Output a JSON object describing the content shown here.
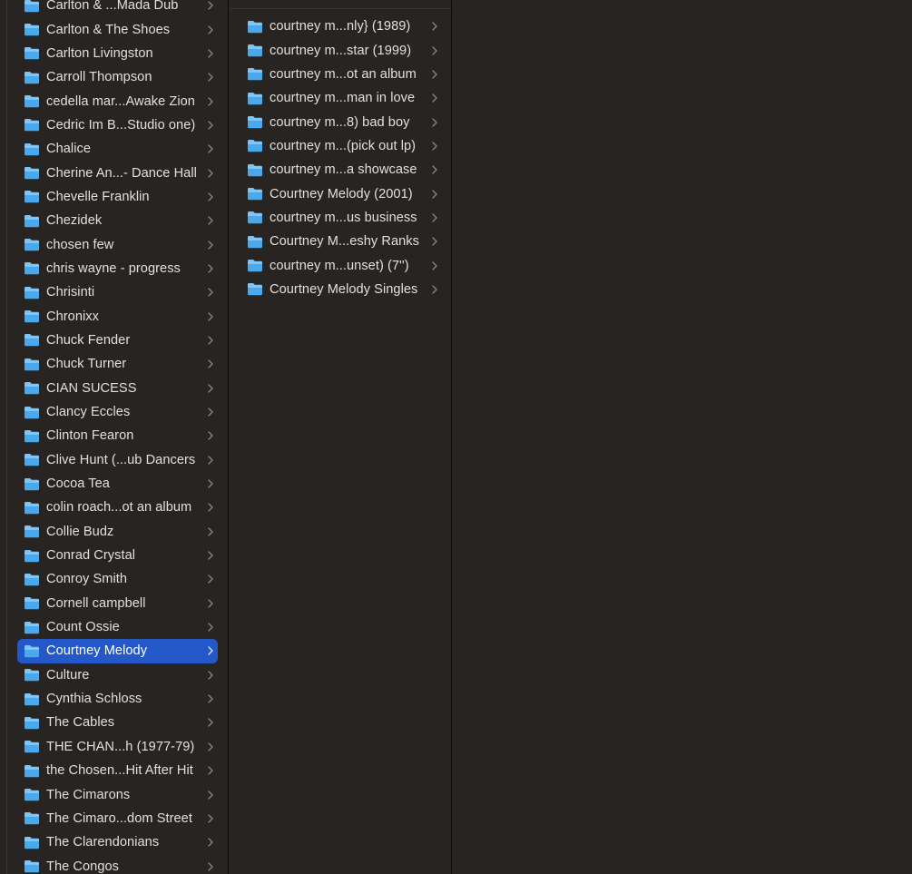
{
  "colors": {
    "background": "#272422",
    "selection": "#2457c8",
    "text": "#e2dfdd",
    "folder_top": "#7cc3f5",
    "folder_body": "#4aa9ec",
    "chevron": "#8a8684"
  },
  "column1": {
    "items": [
      {
        "label": "Carlton & ...Mada Dub",
        "icon": "folder-icon",
        "selected": false
      },
      {
        "label": "Carlton & The Shoes",
        "icon": "folder-icon",
        "selected": false
      },
      {
        "label": "Carlton Livingston",
        "icon": "folder-icon",
        "selected": false
      },
      {
        "label": "Carroll Thompson",
        "icon": "folder-icon",
        "selected": false
      },
      {
        "label": "cedella mar...Awake Zion",
        "icon": "folder-icon",
        "selected": false
      },
      {
        "label": "Cedric Im B...Studio one)",
        "icon": "folder-icon",
        "selected": false
      },
      {
        "label": "Chalice",
        "icon": "folder-icon",
        "selected": false
      },
      {
        "label": "Cherine An...- Dance Hall",
        "icon": "folder-icon",
        "selected": false
      },
      {
        "label": "Chevelle Franklin",
        "icon": "folder-icon",
        "selected": false
      },
      {
        "label": "Chezidek",
        "icon": "folder-icon",
        "selected": false
      },
      {
        "label": "chosen few",
        "icon": "folder-icon",
        "selected": false
      },
      {
        "label": "chris wayne - progress",
        "icon": "folder-icon",
        "selected": false
      },
      {
        "label": "Chrisinti",
        "icon": "folder-icon",
        "selected": false
      },
      {
        "label": "Chronixx",
        "icon": "folder-icon",
        "selected": false
      },
      {
        "label": "Chuck Fender",
        "icon": "folder-icon",
        "selected": false
      },
      {
        "label": "Chuck Turner",
        "icon": "folder-icon",
        "selected": false
      },
      {
        "label": "CIAN SUCESS",
        "icon": "folder-icon",
        "selected": false
      },
      {
        "label": "Clancy Eccles",
        "icon": "folder-icon",
        "selected": false
      },
      {
        "label": "Clinton Fearon",
        "icon": "folder-icon",
        "selected": false
      },
      {
        "label": "Clive Hunt (...ub Dancers",
        "icon": "folder-icon",
        "selected": false
      },
      {
        "label": "Cocoa Tea",
        "icon": "folder-icon",
        "selected": false
      },
      {
        "label": "colin roach...ot an album",
        "icon": "folder-icon",
        "selected": false
      },
      {
        "label": "Collie Budz",
        "icon": "folder-icon",
        "selected": false
      },
      {
        "label": "Conrad Crystal",
        "icon": "folder-icon",
        "selected": false
      },
      {
        "label": "Conroy Smith",
        "icon": "folder-icon",
        "selected": false
      },
      {
        "label": "Cornell campbell",
        "icon": "folder-icon",
        "selected": false
      },
      {
        "label": "Count Ossie",
        "icon": "folder-icon",
        "selected": false
      },
      {
        "label": "Courtney Melody",
        "icon": "folder-icon",
        "selected": true
      },
      {
        "label": "Culture",
        "icon": "folder-icon",
        "selected": false
      },
      {
        "label": "Cynthia Schloss",
        "icon": "folder-icon",
        "selected": false
      },
      {
        "label": "The Cables",
        "icon": "folder-icon",
        "selected": false
      },
      {
        "label": "THE CHAN...h (1977-79)",
        "icon": "folder-icon",
        "selected": false
      },
      {
        "label": "the Chosen...Hit After Hit",
        "icon": "folder-icon",
        "selected": false
      },
      {
        "label": "The Cimarons",
        "icon": "folder-icon",
        "selected": false
      },
      {
        "label": "The Cimaro...dom Street",
        "icon": "folder-icon",
        "selected": false
      },
      {
        "label": "The Clarendonians",
        "icon": "folder-icon",
        "selected": false
      },
      {
        "label": "The Congos",
        "icon": "folder-icon",
        "selected": false
      }
    ]
  },
  "column2": {
    "items": [
      {
        "label": "courtney m...nly} (1989)",
        "icon": "folder-icon",
        "selected": false
      },
      {
        "label": "courtney m...star (1999)",
        "icon": "folder-icon",
        "selected": false
      },
      {
        "label": "courtney m...ot an album",
        "icon": "folder-icon",
        "selected": false
      },
      {
        "label": "courtney m...man in love",
        "icon": "folder-icon",
        "selected": false
      },
      {
        "label": "courtney m...8) bad boy",
        "icon": "folder-icon",
        "selected": false
      },
      {
        "label": "courtney m...(pick out lp)",
        "icon": "folder-icon",
        "selected": false
      },
      {
        "label": "courtney m...a showcase",
        "icon": "folder-icon",
        "selected": false
      },
      {
        "label": "Courtney Melody (2001)",
        "icon": "folder-icon",
        "selected": false
      },
      {
        "label": "courtney m...us business",
        "icon": "folder-icon",
        "selected": false
      },
      {
        "label": "Courtney M...eshy Ranks",
        "icon": "folder-icon",
        "selected": false
      },
      {
        "label": "courtney m...unset) (7'')",
        "icon": "folder-icon",
        "selected": false
      },
      {
        "label": "Courtney Melody Singles",
        "icon": "folder-icon",
        "selected": false
      }
    ]
  }
}
